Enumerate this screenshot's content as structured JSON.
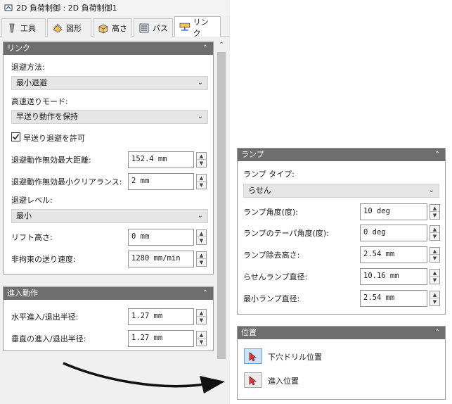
{
  "window": {
    "title": "2D 負荷制御 : 2D 負荷制御1"
  },
  "tabs": [
    {
      "label": "工具",
      "icon": "tool-icon"
    },
    {
      "label": "図形",
      "icon": "shape-icon"
    },
    {
      "label": "高さ",
      "icon": "height-icon"
    },
    {
      "label": "パス",
      "icon": "passes-icon"
    },
    {
      "label": "リンク",
      "icon": "linking-icon",
      "active": true
    }
  ],
  "link_panel": {
    "header": "リンク",
    "retract_method_label": "退避方法:",
    "retract_method_value": "最小退避",
    "rapid_feed_mode_label": "高速送りモード:",
    "rapid_feed_mode_value": "早送り動作を保持",
    "allow_rapid_retract_label": "早送り退避を許可",
    "allow_rapid_retract_checked": true,
    "max_stay_down_distance_label": "退避動作無効最大距離:",
    "max_stay_down_distance_value": "152.4 mm",
    "min_stay_down_clearance_label": "退避動作無効最小クリアランス:",
    "min_stay_down_clearance_value": "2 mm",
    "retract_level_label": "退避レベル:",
    "retract_level_value": "最小",
    "lift_height_label": "リフト高さ:",
    "lift_height_value": "0 mm",
    "unconstrained_feed_label": "非拘束の送り速度:",
    "unconstrained_feed_value": "1280 mm/min"
  },
  "entry_panel": {
    "header": "進入動作",
    "horizontal_radius_label": "水平進入/退出半径:",
    "horizontal_radius_value": "1.27 mm",
    "vertical_radius_label": "垂直の進入/退出半径:",
    "vertical_radius_value": "1.27 mm"
  },
  "ramp_panel": {
    "header": "ランプ",
    "ramp_type_label": "ランプ タイプ:",
    "ramp_type_value": "らせん",
    "ramp_angle_label": "ランプ角度(度):",
    "ramp_angle_value": "10 deg",
    "ramp_taper_label": "ランプのテーパ角度(度):",
    "ramp_taper_value": "0 deg",
    "ramp_clearance_label": "ランプ除去高さ:",
    "ramp_clearance_value": "2.54 mm",
    "helix_diameter_label": "らせんランプ直径:",
    "helix_diameter_value": "10.16 mm",
    "min_ramp_diameter_label": "最小ランプ直径:",
    "min_ramp_diameter_value": "2.54 mm"
  },
  "position_panel": {
    "header": "位置",
    "predrill_label": "下穴ドリル位置",
    "entry_label": "進入位置"
  },
  "colors": {
    "panel_header": "#6e6e6e",
    "selected_button": "#cde3f7",
    "field_bg": "#e5e5e5"
  }
}
